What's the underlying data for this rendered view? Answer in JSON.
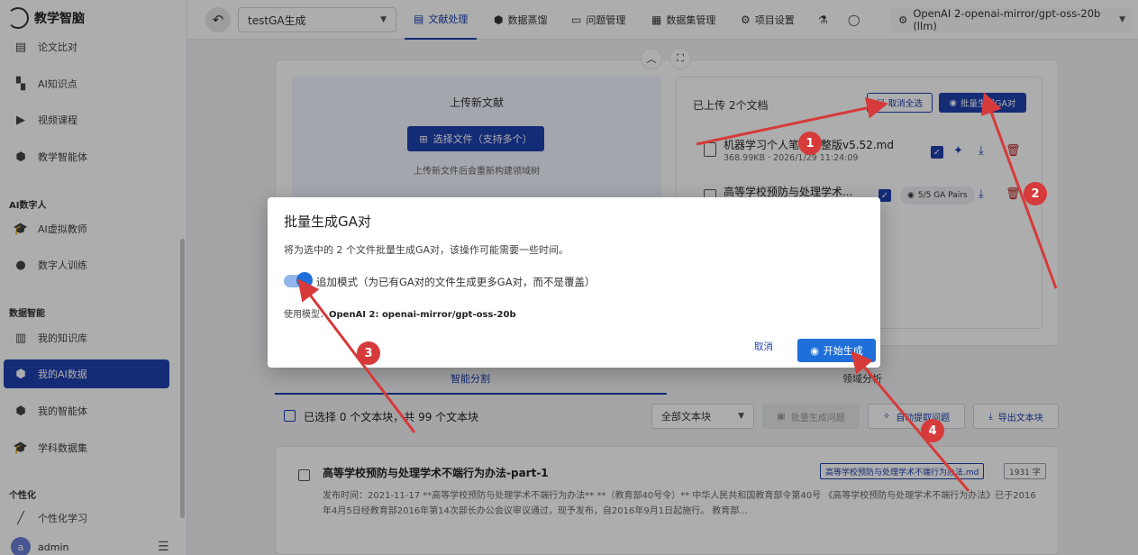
{
  "app": {
    "title": "教学智脑"
  },
  "sidebar": {
    "items_top": [
      {
        "label": "论文比对",
        "icon": "compare-icon"
      },
      {
        "label": "AI知识点",
        "icon": "clapper-icon"
      },
      {
        "label": "视频课程",
        "icon": "video-icon"
      },
      {
        "label": "教学智能体",
        "icon": "cube-icon"
      }
    ],
    "section_ai_human": "AI数字人",
    "items_ai_human": [
      {
        "label": "AI虚拟教师",
        "icon": "mortarboard-icon"
      },
      {
        "label": "数字人训练",
        "icon": "person-icon"
      }
    ],
    "section_data": "数据智能",
    "items_data": [
      {
        "label": "我的知识库",
        "icon": "book-icon"
      },
      {
        "label": "我的AI数据",
        "icon": "cube-icon",
        "active": true
      },
      {
        "label": "我的智能体",
        "icon": "cube-icon"
      },
      {
        "label": "学科数据集",
        "icon": "mortarboard-icon"
      }
    ],
    "section_personal": "个性化",
    "items_personal": [
      {
        "label": "个性化学习",
        "icon": "wand-icon"
      }
    ],
    "user": {
      "avatar_letter": "a",
      "name": "admin"
    }
  },
  "topbar": {
    "project": "testGA生成",
    "tabs": [
      {
        "label": "文献处理",
        "active": true
      },
      {
        "label": "数据蒸馏"
      },
      {
        "label": "问题管理"
      },
      {
        "label": "数据集管理"
      },
      {
        "label": "项目设置"
      }
    ],
    "model": "OpenAI 2-openai-mirror/gpt-oss-20b (llm)"
  },
  "upload": {
    "title": "上传新文献",
    "select_button": "选择文件（支持多个）",
    "hint": "上传新文件后会重新构建领域树"
  },
  "files": {
    "count_text": "已上传 2个文档",
    "deselect_label": "取消全选",
    "batch_label": "批量生成GA对",
    "list": [
      {
        "name": "机器学习个人笔记完整版v5.52.md",
        "meta": "368.99KB · 2026/1/29 11:24:09"
      },
      {
        "name": "高等学校预防与处理学术...",
        "pairs": "5/5 GA Pairs"
      }
    ]
  },
  "subtabs": {
    "a": "智能分割",
    "b": "领域分析"
  },
  "chunks": {
    "selected_text": "已选择 0 个文本块，共 99 个文本块",
    "filter": "全部文本块",
    "btn_batch_q": "批量生成问题",
    "btn_auto_q": "自动提取问题",
    "btn_export": "导出文本块",
    "card": {
      "title": "高等学校预防与处理学术不端行为办法-part-1",
      "tag": "高等学校预防与处理学术不端行为办法.md",
      "count": "1931 字",
      "body": "发布时间：2021-11-17 **高等学校预防与处理学术不端行为办法** **（教育部40号令）** 中华人民共和国教育部令第40号 《高等学校预防与处理学术不端行为办法》已于2016年4月5日经教育部2016年第14次部长办公会议审议通过，现予发布，自2016年9月1日起施行。 教育部..."
    }
  },
  "dialog": {
    "title": "批量生成GA对",
    "desc": "将为选中的 2 个文件批量生成GA对，该操作可能需要一些时间。",
    "switch_label": "追加模式（为已有GA对的文件生成更多GA对，而不是覆盖）",
    "model_prefix": "使用模型：",
    "model_name": "OpenAI 2: openai-mirror/gpt-oss-20b",
    "cancel": "取消",
    "start": "开始生成"
  },
  "annotations": [
    "1",
    "2",
    "3",
    "4"
  ],
  "colors": {
    "primary": "#1e40af",
    "accent": "#1e6fd9",
    "annotation": "#d63a3a",
    "danger": "#b91c1c"
  }
}
